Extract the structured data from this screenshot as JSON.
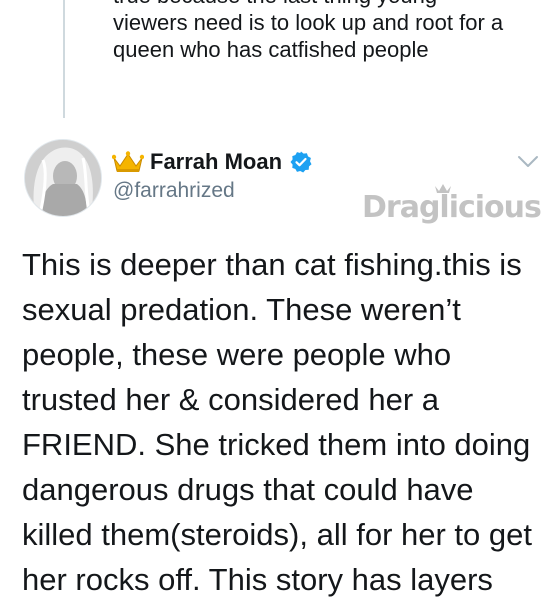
{
  "previous_tweet": {
    "lines": [
      "true because the last thing young",
      "viewers need is to look up and root for a",
      "queen who has catfished people"
    ]
  },
  "author": {
    "crown_emoji_icon": "crown-icon",
    "display_name": "Farrah Moan",
    "verified_icon": "verified-badge-icon",
    "handle": "@farrahrized"
  },
  "watermark": {
    "text": "Draglicious"
  },
  "tweet": {
    "lines": [
      "This is deeper than cat fishing.this is",
      "sexual predation. These weren’t",
      "people, these were people who",
      "trusted her & considered her a",
      "FRIEND. She tricked them into doing",
      "dangerous drugs that could have",
      "killed them(steroids), all for her to get",
      "her rocks off. This story has layers"
    ]
  },
  "colors": {
    "verified_blue": "#1da1f2",
    "handle_gray": "#657786",
    "thread_line": "#cfd9de"
  }
}
